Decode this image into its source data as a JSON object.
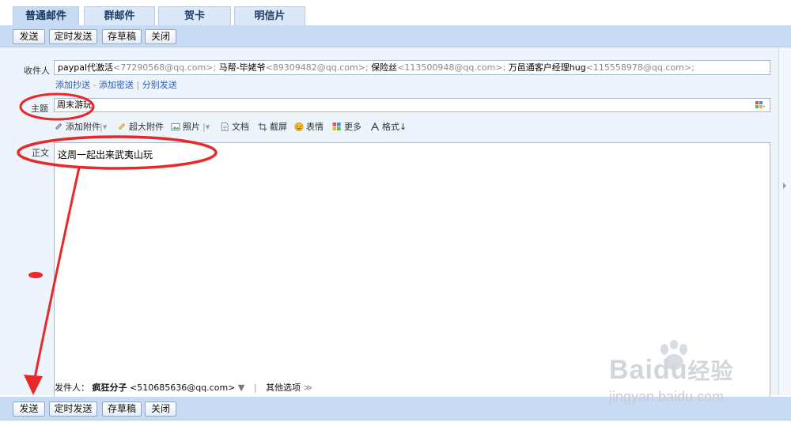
{
  "tabs": [
    "普通邮件",
    "群邮件",
    "贺卡",
    "明信片"
  ],
  "toolbar": {
    "send": "发送",
    "scheduled_send": "定时发送",
    "save_draft": "存草稿",
    "close": "关闭"
  },
  "recipients": {
    "label": "收件人",
    "list": [
      {
        "name": "paypal代激活",
        "email": "<77290568@qq.com>;"
      },
      {
        "name": "马帮-毕姥爷",
        "email": "<89309482@qq.com>;"
      },
      {
        "name": "保险丝",
        "email": "<113500948@qq.com>;"
      },
      {
        "name": "万邑通客户经理hug",
        "email": "<115558978@qq.com>;"
      }
    ],
    "add_cc": "添加抄送",
    "dash": "-",
    "add_bcc": "添加密送",
    "separator": "|",
    "separate_send": "分别发送"
  },
  "subject": {
    "label": "主题",
    "value": "周末游玩"
  },
  "editor_toolbar": {
    "attach": "添加附件",
    "big_attach": "超大附件",
    "photo": "照片",
    "document": "文档",
    "screenshot": "截屏",
    "emoji": "表情",
    "more": "更多",
    "format": "格式↓"
  },
  "body": {
    "label": "正文",
    "value": "这周一起出来武夷山玩"
  },
  "sender": {
    "label": "发件人：",
    "name": "疯狂分子",
    "email": "<510685636@qq.com>",
    "dropdown": "▼",
    "separator": "|",
    "other_options": "其他选项",
    "other_options_arrow": "≫"
  },
  "watermark": {
    "brand": "Bai",
    "brand_tail": "du",
    "brand_cn": "经验",
    "url": "jingyan.baidu.com"
  },
  "colors": {
    "toolbar": "#c7dcf4",
    "tab": "#dbe8f7",
    "link": "#2a5db0",
    "annotation": "#e8292a"
  }
}
